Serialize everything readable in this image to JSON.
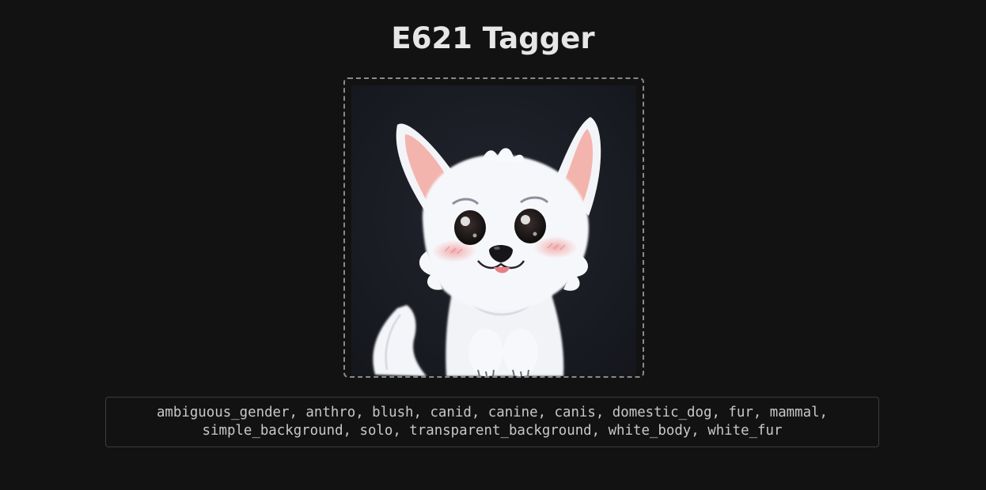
{
  "app": {
    "title": "E621 Tagger"
  },
  "upload": {
    "image_description_icon": "white-canine-illustration"
  },
  "tags": {
    "text": "ambiguous_gender, anthro, blush, canid, canine, canis, domestic_dog, fur, mammal, simple_background, solo, transparent_background, white_body, white_fur"
  },
  "colors": {
    "background": "#121212",
    "title": "#e6e6e6",
    "dropzone_border": "#8a8a8a",
    "tags_border": "#3c3c3c",
    "tags_text": "#c8c8c8"
  }
}
